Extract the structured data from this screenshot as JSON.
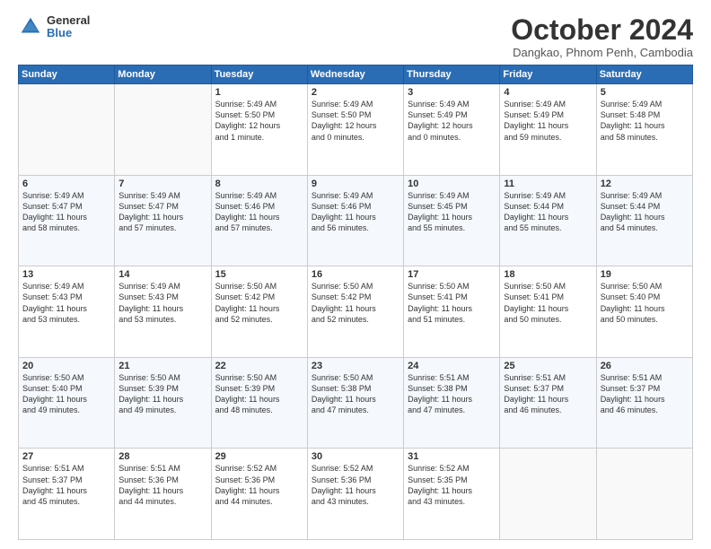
{
  "logo": {
    "general": "General",
    "blue": "Blue"
  },
  "header": {
    "month": "October 2024",
    "location": "Dangkao, Phnom Penh, Cambodia"
  },
  "days_of_week": [
    "Sunday",
    "Monday",
    "Tuesday",
    "Wednesday",
    "Thursday",
    "Friday",
    "Saturday"
  ],
  "weeks": [
    [
      {
        "day": "",
        "content": ""
      },
      {
        "day": "",
        "content": ""
      },
      {
        "day": "1",
        "content": "Sunrise: 5:49 AM\nSunset: 5:50 PM\nDaylight: 12 hours\nand 1 minute."
      },
      {
        "day": "2",
        "content": "Sunrise: 5:49 AM\nSunset: 5:50 PM\nDaylight: 12 hours\nand 0 minutes."
      },
      {
        "day": "3",
        "content": "Sunrise: 5:49 AM\nSunset: 5:49 PM\nDaylight: 12 hours\nand 0 minutes."
      },
      {
        "day": "4",
        "content": "Sunrise: 5:49 AM\nSunset: 5:49 PM\nDaylight: 11 hours\nand 59 minutes."
      },
      {
        "day": "5",
        "content": "Sunrise: 5:49 AM\nSunset: 5:48 PM\nDaylight: 11 hours\nand 58 minutes."
      }
    ],
    [
      {
        "day": "6",
        "content": "Sunrise: 5:49 AM\nSunset: 5:47 PM\nDaylight: 11 hours\nand 58 minutes."
      },
      {
        "day": "7",
        "content": "Sunrise: 5:49 AM\nSunset: 5:47 PM\nDaylight: 11 hours\nand 57 minutes."
      },
      {
        "day": "8",
        "content": "Sunrise: 5:49 AM\nSunset: 5:46 PM\nDaylight: 11 hours\nand 57 minutes."
      },
      {
        "day": "9",
        "content": "Sunrise: 5:49 AM\nSunset: 5:46 PM\nDaylight: 11 hours\nand 56 minutes."
      },
      {
        "day": "10",
        "content": "Sunrise: 5:49 AM\nSunset: 5:45 PM\nDaylight: 11 hours\nand 55 minutes."
      },
      {
        "day": "11",
        "content": "Sunrise: 5:49 AM\nSunset: 5:44 PM\nDaylight: 11 hours\nand 55 minutes."
      },
      {
        "day": "12",
        "content": "Sunrise: 5:49 AM\nSunset: 5:44 PM\nDaylight: 11 hours\nand 54 minutes."
      }
    ],
    [
      {
        "day": "13",
        "content": "Sunrise: 5:49 AM\nSunset: 5:43 PM\nDaylight: 11 hours\nand 53 minutes."
      },
      {
        "day": "14",
        "content": "Sunrise: 5:49 AM\nSunset: 5:43 PM\nDaylight: 11 hours\nand 53 minutes."
      },
      {
        "day": "15",
        "content": "Sunrise: 5:50 AM\nSunset: 5:42 PM\nDaylight: 11 hours\nand 52 minutes."
      },
      {
        "day": "16",
        "content": "Sunrise: 5:50 AM\nSunset: 5:42 PM\nDaylight: 11 hours\nand 52 minutes."
      },
      {
        "day": "17",
        "content": "Sunrise: 5:50 AM\nSunset: 5:41 PM\nDaylight: 11 hours\nand 51 minutes."
      },
      {
        "day": "18",
        "content": "Sunrise: 5:50 AM\nSunset: 5:41 PM\nDaylight: 11 hours\nand 50 minutes."
      },
      {
        "day": "19",
        "content": "Sunrise: 5:50 AM\nSunset: 5:40 PM\nDaylight: 11 hours\nand 50 minutes."
      }
    ],
    [
      {
        "day": "20",
        "content": "Sunrise: 5:50 AM\nSunset: 5:40 PM\nDaylight: 11 hours\nand 49 minutes."
      },
      {
        "day": "21",
        "content": "Sunrise: 5:50 AM\nSunset: 5:39 PM\nDaylight: 11 hours\nand 49 minutes."
      },
      {
        "day": "22",
        "content": "Sunrise: 5:50 AM\nSunset: 5:39 PM\nDaylight: 11 hours\nand 48 minutes."
      },
      {
        "day": "23",
        "content": "Sunrise: 5:50 AM\nSunset: 5:38 PM\nDaylight: 11 hours\nand 47 minutes."
      },
      {
        "day": "24",
        "content": "Sunrise: 5:51 AM\nSunset: 5:38 PM\nDaylight: 11 hours\nand 47 minutes."
      },
      {
        "day": "25",
        "content": "Sunrise: 5:51 AM\nSunset: 5:37 PM\nDaylight: 11 hours\nand 46 minutes."
      },
      {
        "day": "26",
        "content": "Sunrise: 5:51 AM\nSunset: 5:37 PM\nDaylight: 11 hours\nand 46 minutes."
      }
    ],
    [
      {
        "day": "27",
        "content": "Sunrise: 5:51 AM\nSunset: 5:37 PM\nDaylight: 11 hours\nand 45 minutes."
      },
      {
        "day": "28",
        "content": "Sunrise: 5:51 AM\nSunset: 5:36 PM\nDaylight: 11 hours\nand 44 minutes."
      },
      {
        "day": "29",
        "content": "Sunrise: 5:52 AM\nSunset: 5:36 PM\nDaylight: 11 hours\nand 44 minutes."
      },
      {
        "day": "30",
        "content": "Sunrise: 5:52 AM\nSunset: 5:36 PM\nDaylight: 11 hours\nand 43 minutes."
      },
      {
        "day": "31",
        "content": "Sunrise: 5:52 AM\nSunset: 5:35 PM\nDaylight: 11 hours\nand 43 minutes."
      },
      {
        "day": "",
        "content": ""
      },
      {
        "day": "",
        "content": ""
      }
    ]
  ]
}
